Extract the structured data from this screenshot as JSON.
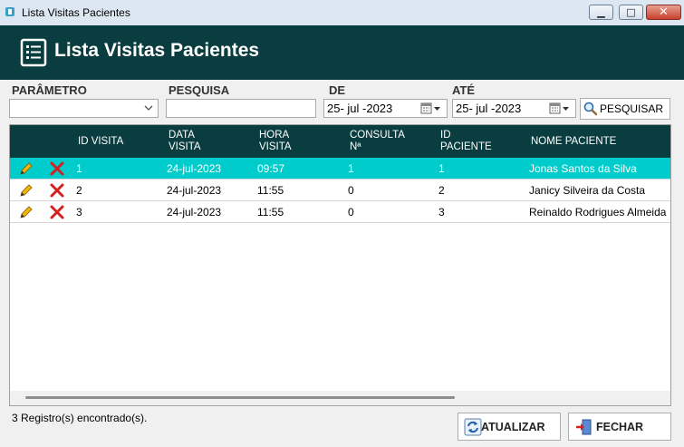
{
  "window": {
    "title": "Lista Visitas Pacientes"
  },
  "header": {
    "title": "Lista Visitas Pacientes"
  },
  "filters": {
    "parametro_label": "PARÂMETRO",
    "parametro_value": "",
    "pesquisa_label": "PESQUISA",
    "pesquisa_value": "",
    "de_label": "DE",
    "de_value": "25- jul -2023",
    "ate_label": "ATÉ",
    "ate_value": "25- jul -2023",
    "search_button": "PESQUISAR"
  },
  "table": {
    "columns": [
      {
        "l1": "ID VISITA",
        "l2": ""
      },
      {
        "l1": "DATA",
        "l2": "VISITA"
      },
      {
        "l1": "HORA",
        "l2": "VISITA"
      },
      {
        "l1": "CONSULTA",
        "l2": "Nª"
      },
      {
        "l1": "ID",
        "l2": "PACIENTE"
      },
      {
        "l1": "NOME PACIENTE",
        "l2": ""
      }
    ],
    "rows": [
      {
        "id": "1",
        "data": "24-jul-2023",
        "hora": "09:57",
        "consulta": "1",
        "paciente_id": "1",
        "nome": "Jonas Santos da Silva"
      },
      {
        "id": "2",
        "data": "24-jul-2023",
        "hora": "11:55",
        "consulta": "0",
        "paciente_id": "2",
        "nome": "Janicy Silveira da Costa"
      },
      {
        "id": "3",
        "data": "24-jul-2023",
        "hora": "11:55",
        "consulta": "0",
        "paciente_id": "3",
        "nome": "Reinaldo Rodrigues Almeida"
      }
    ]
  },
  "footer": {
    "status": "3 Registro(s) encontrado(s).",
    "refresh_button": "ATUALIZAR",
    "close_button": "FECHAR"
  },
  "colors": {
    "header_bg": "#0a3d40",
    "selected_row": "#00cccc"
  },
  "icons": [
    "app-icon",
    "list-icon",
    "chevron-down-icon",
    "calendar-icon",
    "search-icon",
    "edit-icon",
    "delete-icon",
    "refresh-icon",
    "exit-icon"
  ]
}
